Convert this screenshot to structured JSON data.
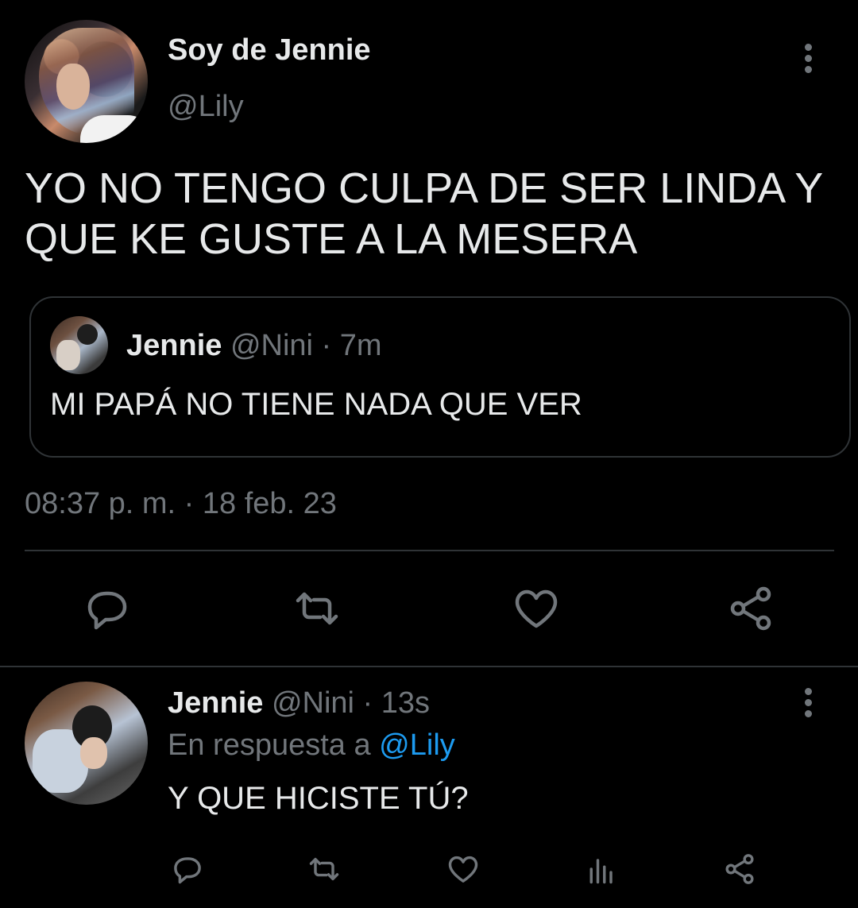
{
  "main_tweet": {
    "display_name": "Soy de Jennie",
    "handle": "@Lily",
    "text_line1": "YO NO TENGO CULPA DE SER LINDA Y",
    "text_line2": "QUE KE GUSTE A LA MESERA",
    "quoted": {
      "display_name": "Jennie",
      "meta": " @Nini · 7m",
      "text": "MI PAPÁ NO TIENE NADA QUE VER"
    },
    "timestamp": "08:37 p. m. · 18 feb. 23",
    "actions": [
      "reply-icon",
      "retweet-icon",
      "like-icon",
      "share-icon"
    ]
  },
  "reply_tweet": {
    "display_name": "Jennie",
    "meta": " @Nini · 13s",
    "reply_prefix": "En respuesta a ",
    "reply_mention": "@Lily",
    "text": "Y QUE HICISTE TÚ?",
    "actions": [
      "reply-icon",
      "retweet-icon",
      "like-icon",
      "views-icon",
      "share-icon"
    ]
  },
  "colors": {
    "background": "#000000",
    "text": "#e7e9ea",
    "muted": "#71767b",
    "link": "#1d9bf0",
    "border": "#2f3336"
  }
}
